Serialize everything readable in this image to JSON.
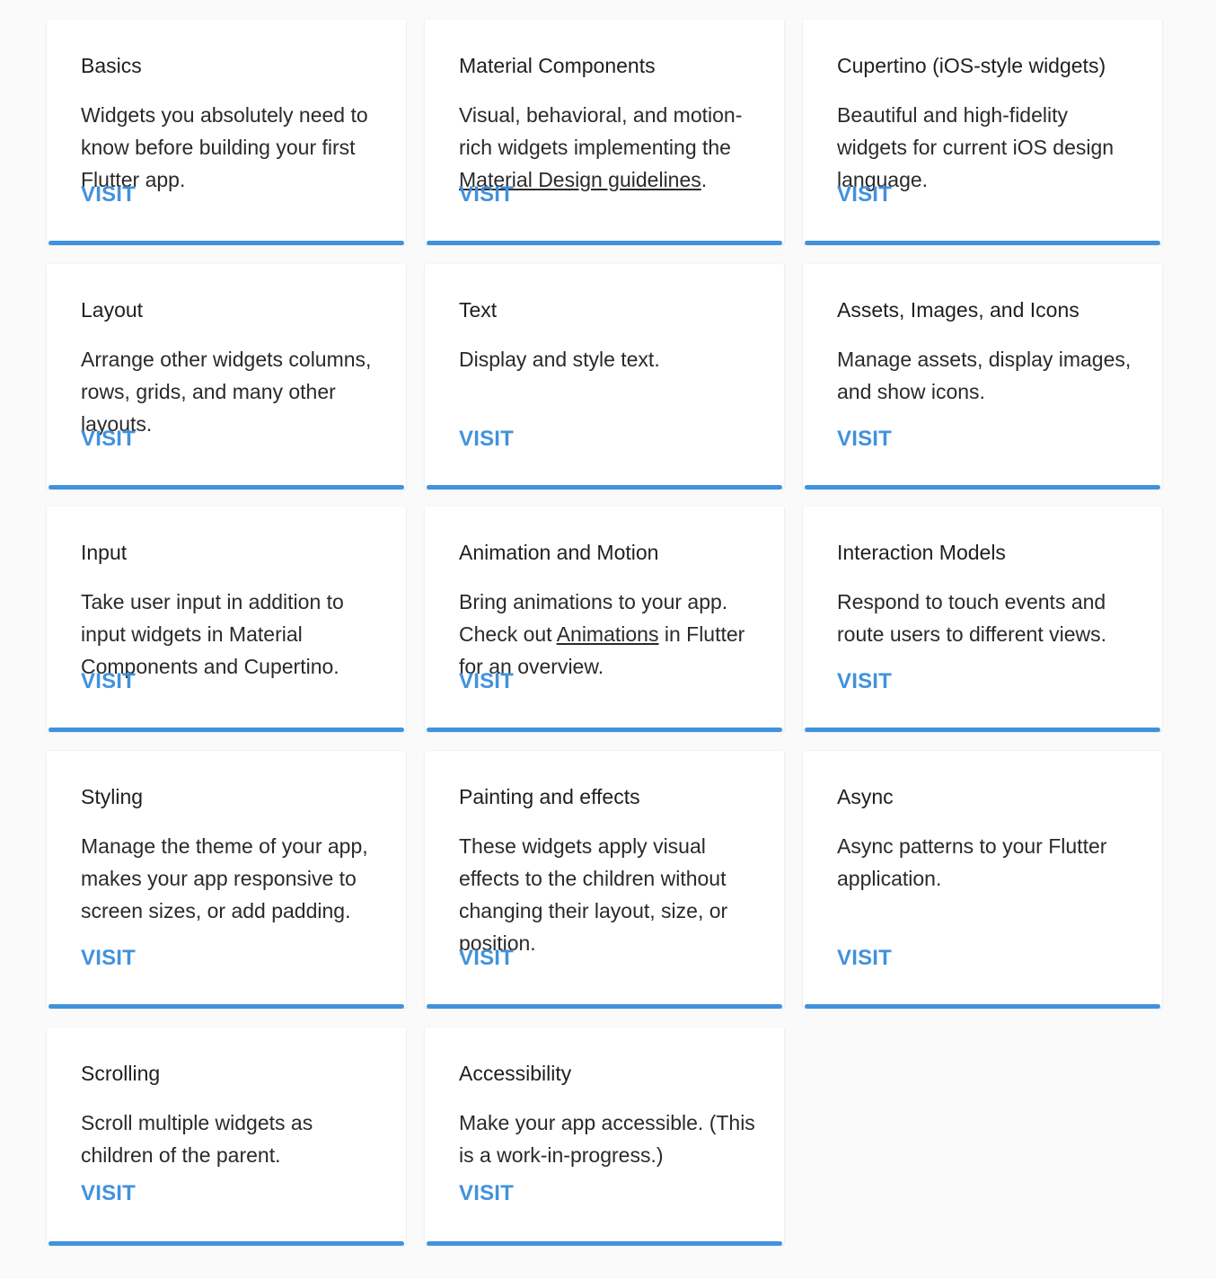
{
  "theme": {
    "accent": "#4192dd",
    "background": "#fafafa",
    "card": "#ffffff"
  },
  "cards": [
    {
      "title": "Basics",
      "desc": "Widgets you absolutely need to know before building your first Flutter app.",
      "visit": "VISIT"
    },
    {
      "title": "Material Components",
      "desc_pre": "Visual, behavioral, and motion-rich widgets implementing the ",
      "desc_link": "Material Design guidelines",
      "desc_post": ".",
      "visit": "VISIT"
    },
    {
      "title": "Cupertino (iOS-style widgets)",
      "desc": "Beautiful and high-fidelity widgets for current iOS design language.",
      "visit": "VISIT"
    },
    {
      "title": "Layout",
      "desc": "Arrange other widgets columns, rows, grids, and many other layouts.",
      "visit": "VISIT"
    },
    {
      "title": "Text",
      "desc": "Display and style text.",
      "visit": "VISIT"
    },
    {
      "title": "Assets, Images, and Icons",
      "desc": "Manage assets, display images, and show icons.",
      "visit": "VISIT"
    },
    {
      "title": "Input",
      "desc": "Take user input in addition to input widgets in Material Components and Cupertino.",
      "visit": "VISIT"
    },
    {
      "title": "Animation and Motion",
      "desc_pre": "Bring animations to your app. Check out ",
      "desc_link": "Animations",
      "desc_post": " in Flutter for an overview.",
      "visit": "VISIT"
    },
    {
      "title": "Interaction Models",
      "desc": "Respond to touch events and route users to different views.",
      "visit": "VISIT"
    },
    {
      "title": "Styling",
      "desc": "Manage the theme of your app, makes your app responsive to screen sizes, or add padding.",
      "visit": "VISIT"
    },
    {
      "title": "Painting and effects",
      "desc": "These widgets apply visual effects to the children without changing their layout, size, or position.",
      "visit": "VISIT"
    },
    {
      "title": "Async",
      "desc": "Async patterns to your Flutter application.",
      "visit": "VISIT"
    },
    {
      "title": "Scrolling",
      "desc": "Scroll multiple widgets as children of the parent.",
      "visit": "VISIT"
    },
    {
      "title": "Accessibility",
      "desc": "Make your app accessible. (This is a work-in-progress.)",
      "visit": "VISIT"
    }
  ]
}
